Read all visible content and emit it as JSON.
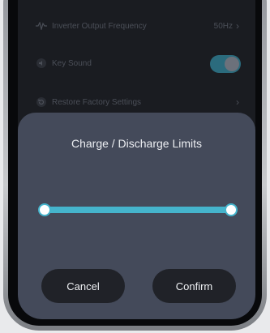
{
  "settings": {
    "rows": [
      {
        "label": "Inverter Output Frequency",
        "value": "50Hz",
        "icon": "wave-icon"
      },
      {
        "label": "Key Sound",
        "icon": "speaker-icon",
        "toggle_on": true
      },
      {
        "label": "Restore Factory Settings",
        "icon": "restore-icon"
      }
    ]
  },
  "dialog": {
    "title": "Charge / Discharge Limits",
    "slider": {
      "low_fraction": 0.0,
      "high_fraction": 1.0
    },
    "cancel_label": "Cancel",
    "confirm_label": "Confirm"
  },
  "colors": {
    "accent": "#45b4cc",
    "toggle_on": "#2b6b7d"
  }
}
